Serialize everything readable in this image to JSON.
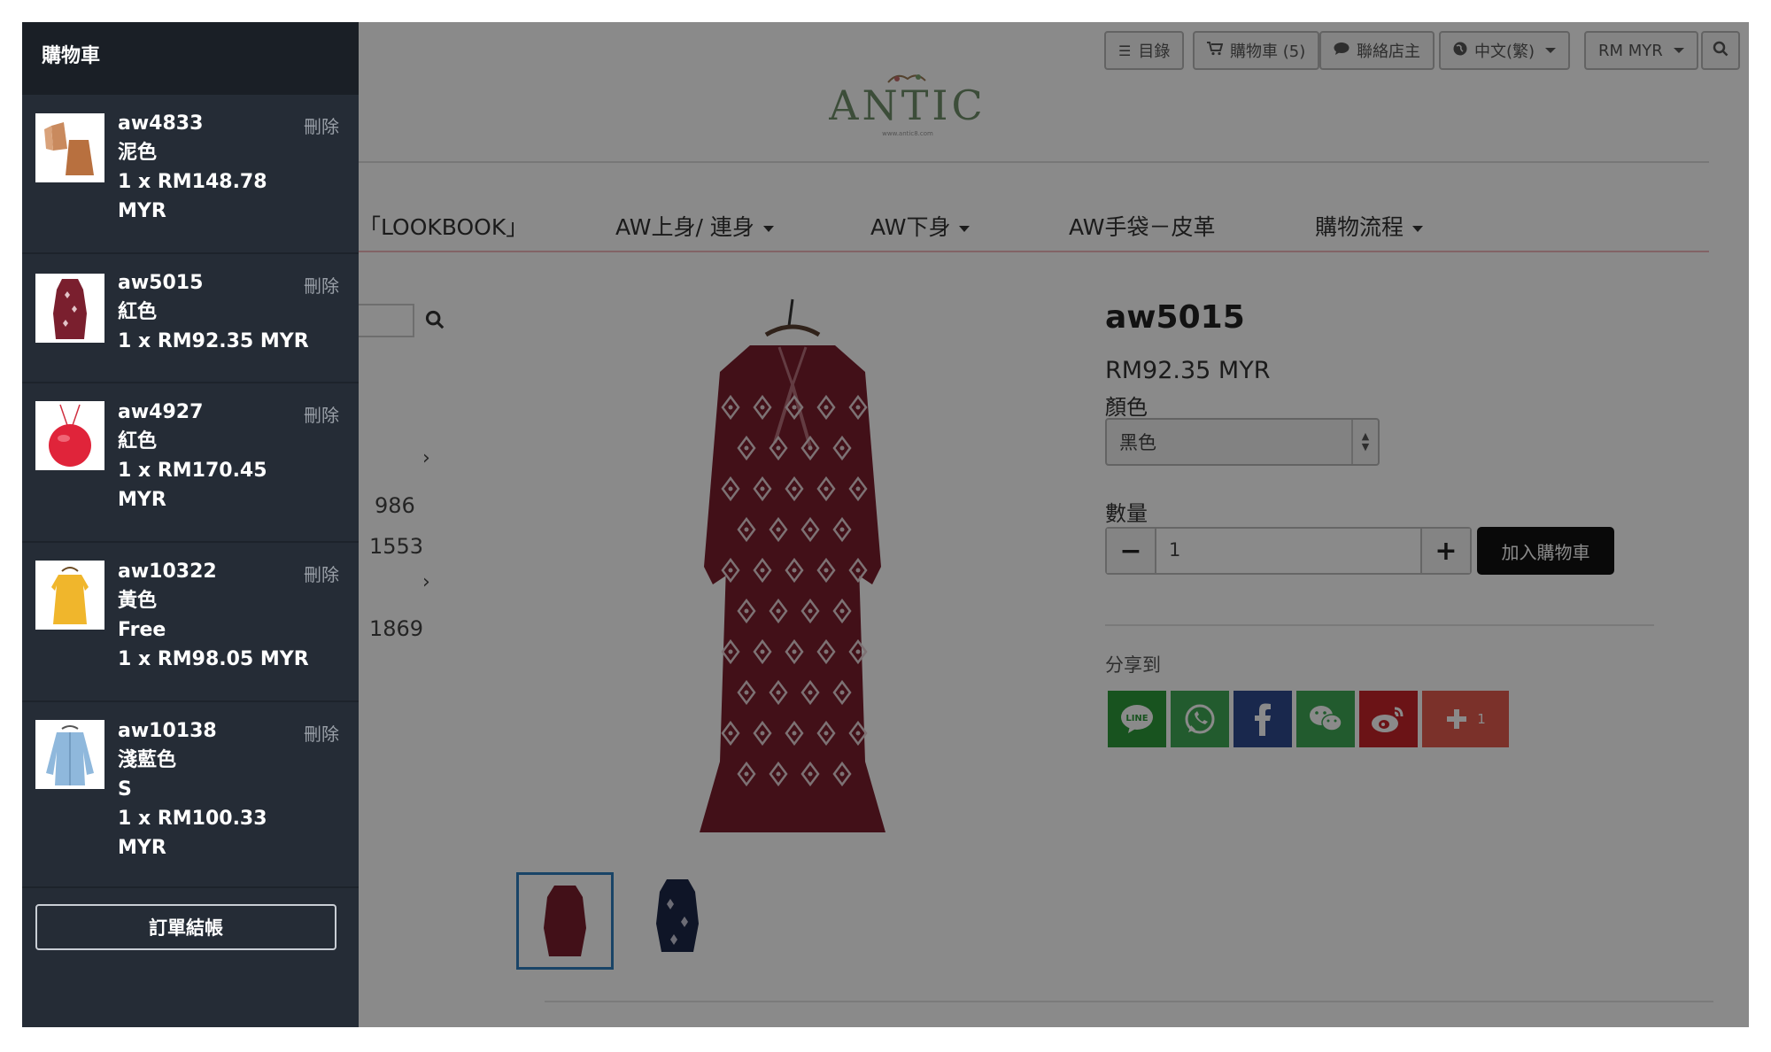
{
  "toolbar": {
    "catalog": "目錄",
    "cart": "購物車 (5)",
    "contact": "聯絡店主",
    "language": "中文(繁)",
    "currency": "RM MYR"
  },
  "logo": {
    "brand": "ANTIC",
    "tagline": "www.antic8.com"
  },
  "nav": {
    "lookbook": "「LOOKBOOK」",
    "tops": "AW上身/ 連身",
    "bottoms": "AW下身",
    "bags": "AW手袋－皮革",
    "process": "購物流程"
  },
  "left_column": {
    "numbers": [
      "986",
      "1553",
      "1869"
    ]
  },
  "product": {
    "title": "aw5015",
    "price": "RM92.35 MYR",
    "color_label": "顏色",
    "color_value": "黑色",
    "qty_label": "數量",
    "qty_value": "1",
    "add_to_cart": "加入購物車",
    "share_label": "分享到",
    "share_count": "1",
    "line_text": "LINE",
    "dress_color": "#7a1f2e"
  },
  "share_colors": {
    "line": "#2e9a3a",
    "whatsapp": "#3fa856",
    "facebook": "#2f4b8f",
    "wechat": "#3fa856",
    "weibo": "#c6242a",
    "more": "#e45b4f"
  },
  "cart": {
    "title": "購物車",
    "delete_label": "刪除",
    "checkout": "訂單結帳",
    "items": [
      {
        "code": "aw4833",
        "color": "泥色",
        "line1": "1 x RM148.78",
        "line2": "MYR"
      },
      {
        "code": "aw5015",
        "color": "紅色",
        "line1": "1 x RM92.35 MYR"
      },
      {
        "code": "aw4927",
        "color": "紅色",
        "line1": "1 x RM170.45",
        "line2": "MYR"
      },
      {
        "code": "aw10322",
        "color": "黃色",
        "size": "Free",
        "line1": "1 x RM98.05 MYR"
      },
      {
        "code": "aw10138",
        "color": "淺藍色",
        "size": "S",
        "line1": "1 x RM100.33",
        "line2": "MYR"
      }
    ]
  }
}
